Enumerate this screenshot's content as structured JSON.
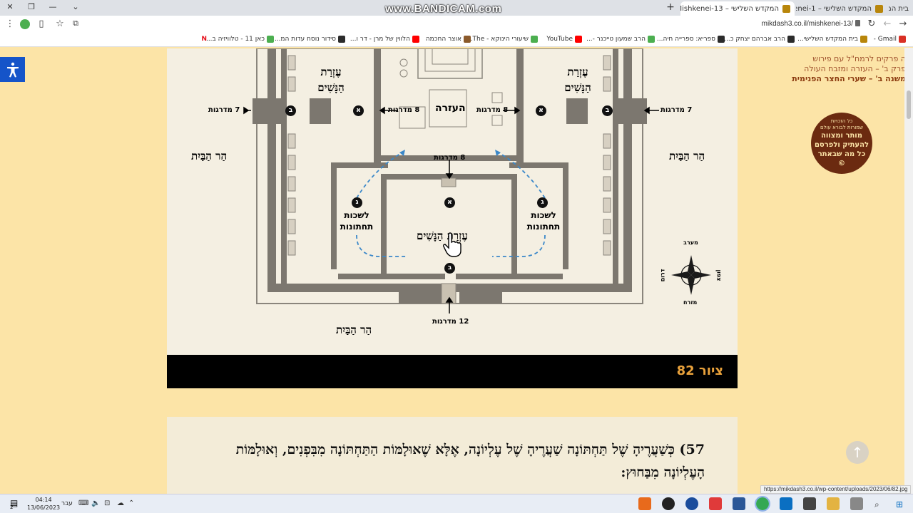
{
  "browser": {
    "watermark": "www.BANDICAM.com",
    "tabs": [
      {
        "title": "המקדש השלישי – Mishkenei-13",
        "close": "✕",
        "active": true
      },
      {
        "title": "המקדש השלישי – Mishkenei-1",
        "close": "✕",
        "active": false
      },
      {
        "title": "בית המקדש השלישי",
        "close": "",
        "active": false
      }
    ],
    "new_tab": "+",
    "url": "mikdash3.co.il/mishkenei-13/",
    "bookmarks": [
      {
        "label": "Gmail -",
        "color": "#d93025"
      },
      {
        "label": "בית המקדש השלישי...",
        "color": "#b8860b"
      },
      {
        "label": "הרב אברהם יצחק כ...",
        "color": "#2b2b2b"
      },
      {
        "label": "ספריא: ספרייה חיה...",
        "color": "#2b2b2b"
      },
      {
        "label": "הרב שמעון טייכנר -...",
        "color": "#4caf50"
      },
      {
        "label": "YouTube",
        "color": "#ff0000"
      },
      {
        "label": "שיעורי הינוקא - The...",
        "color": "#4caf50"
      },
      {
        "label": "אוצר החכמה",
        "color": "#8b5a2b"
      },
      {
        "label": "הלווין של מרן - דר ו...",
        "color": "#ff0000"
      },
      {
        "label": "סידור נוסח עדות המ...",
        "color": "#2b2b2b"
      },
      {
        "label": "כאן 11 - טלוויזיה ב...",
        "color": "#4caf50"
      },
      {
        "label": "N",
        "color": "#e50914"
      }
    ]
  },
  "sidebar": {
    "links": [
      "ה פרקים לרמח\"ל עם פירוש",
      "פרק ב' – העזרה ומזבח העולה",
      "משנה ב' – שערי החצר הפנימית"
    ],
    "stamp": {
      "line1": "כל הזכויות",
      "line2": "שמורות לבורא עולם",
      "line3": "מותר ומצווה",
      "line4": "להעתיק ולפרסם",
      "line5": "כל מה שבאתר",
      "symbol": "©"
    },
    "scroll_up": "↑"
  },
  "diagram": {
    "labels": {
      "ezrat_nashim_left": [
        "עֶזְרַת",
        "הַנָּשִׁים"
      ],
      "ezrat_nashim_right": [
        "עֶזְרַת",
        "הַנָּשִׁים"
      ],
      "ezrat_nashim_center": "עֶזְרַת הַנָּשִׁים",
      "haazara": "העזרה",
      "har_habayit_left": "הַר הַבַּיִת",
      "har_habayit_right": "הַר הַבַּיִת",
      "har_habayit_bottom": "הַר הַבַּיִת",
      "lishkhot_left": [
        "לשכות",
        "תחתונות"
      ],
      "lishkhot_right": [
        "לשכות",
        "תחתונות"
      ],
      "steps_7_left": "7 מדרגות",
      "steps_7_right": "7 מדרגות",
      "steps_8_left": "8 מדרגות",
      "steps_8_right": "8 מדרגות",
      "steps_8_center": "8 מדרגות",
      "steps_12": "12 מדרגות"
    },
    "markers": {
      "alef": "א",
      "bet": "ב",
      "gimel": "ג"
    },
    "compass": {
      "north": "מערב",
      "south": "מזרח",
      "west": "דרום",
      "east": "צפון"
    }
  },
  "caption": "ציור 82",
  "body_text": "57) כְּשַׁעֲרֶיהָ שֶׁל תַּחְתּוֹנָה שַׁעֲרֶיהָ שֶׁל עֶלְיוֹנָה, אֶלָּא שֶׁאוּלָמּוֹת הַתַּחְתּוֹנָה מִבִּפְנִים, וְאוּלָמּוֹת הָעֶלְיוֹנָה מִבַּחוּץ:",
  "status_url": "https://mikdash3.co.il/wp-content/uploads/2023/06/82.jpg",
  "taskbar": {
    "time": "04:14",
    "date": "13/06/2023",
    "lang": "עבר",
    "notif_count": "2"
  }
}
